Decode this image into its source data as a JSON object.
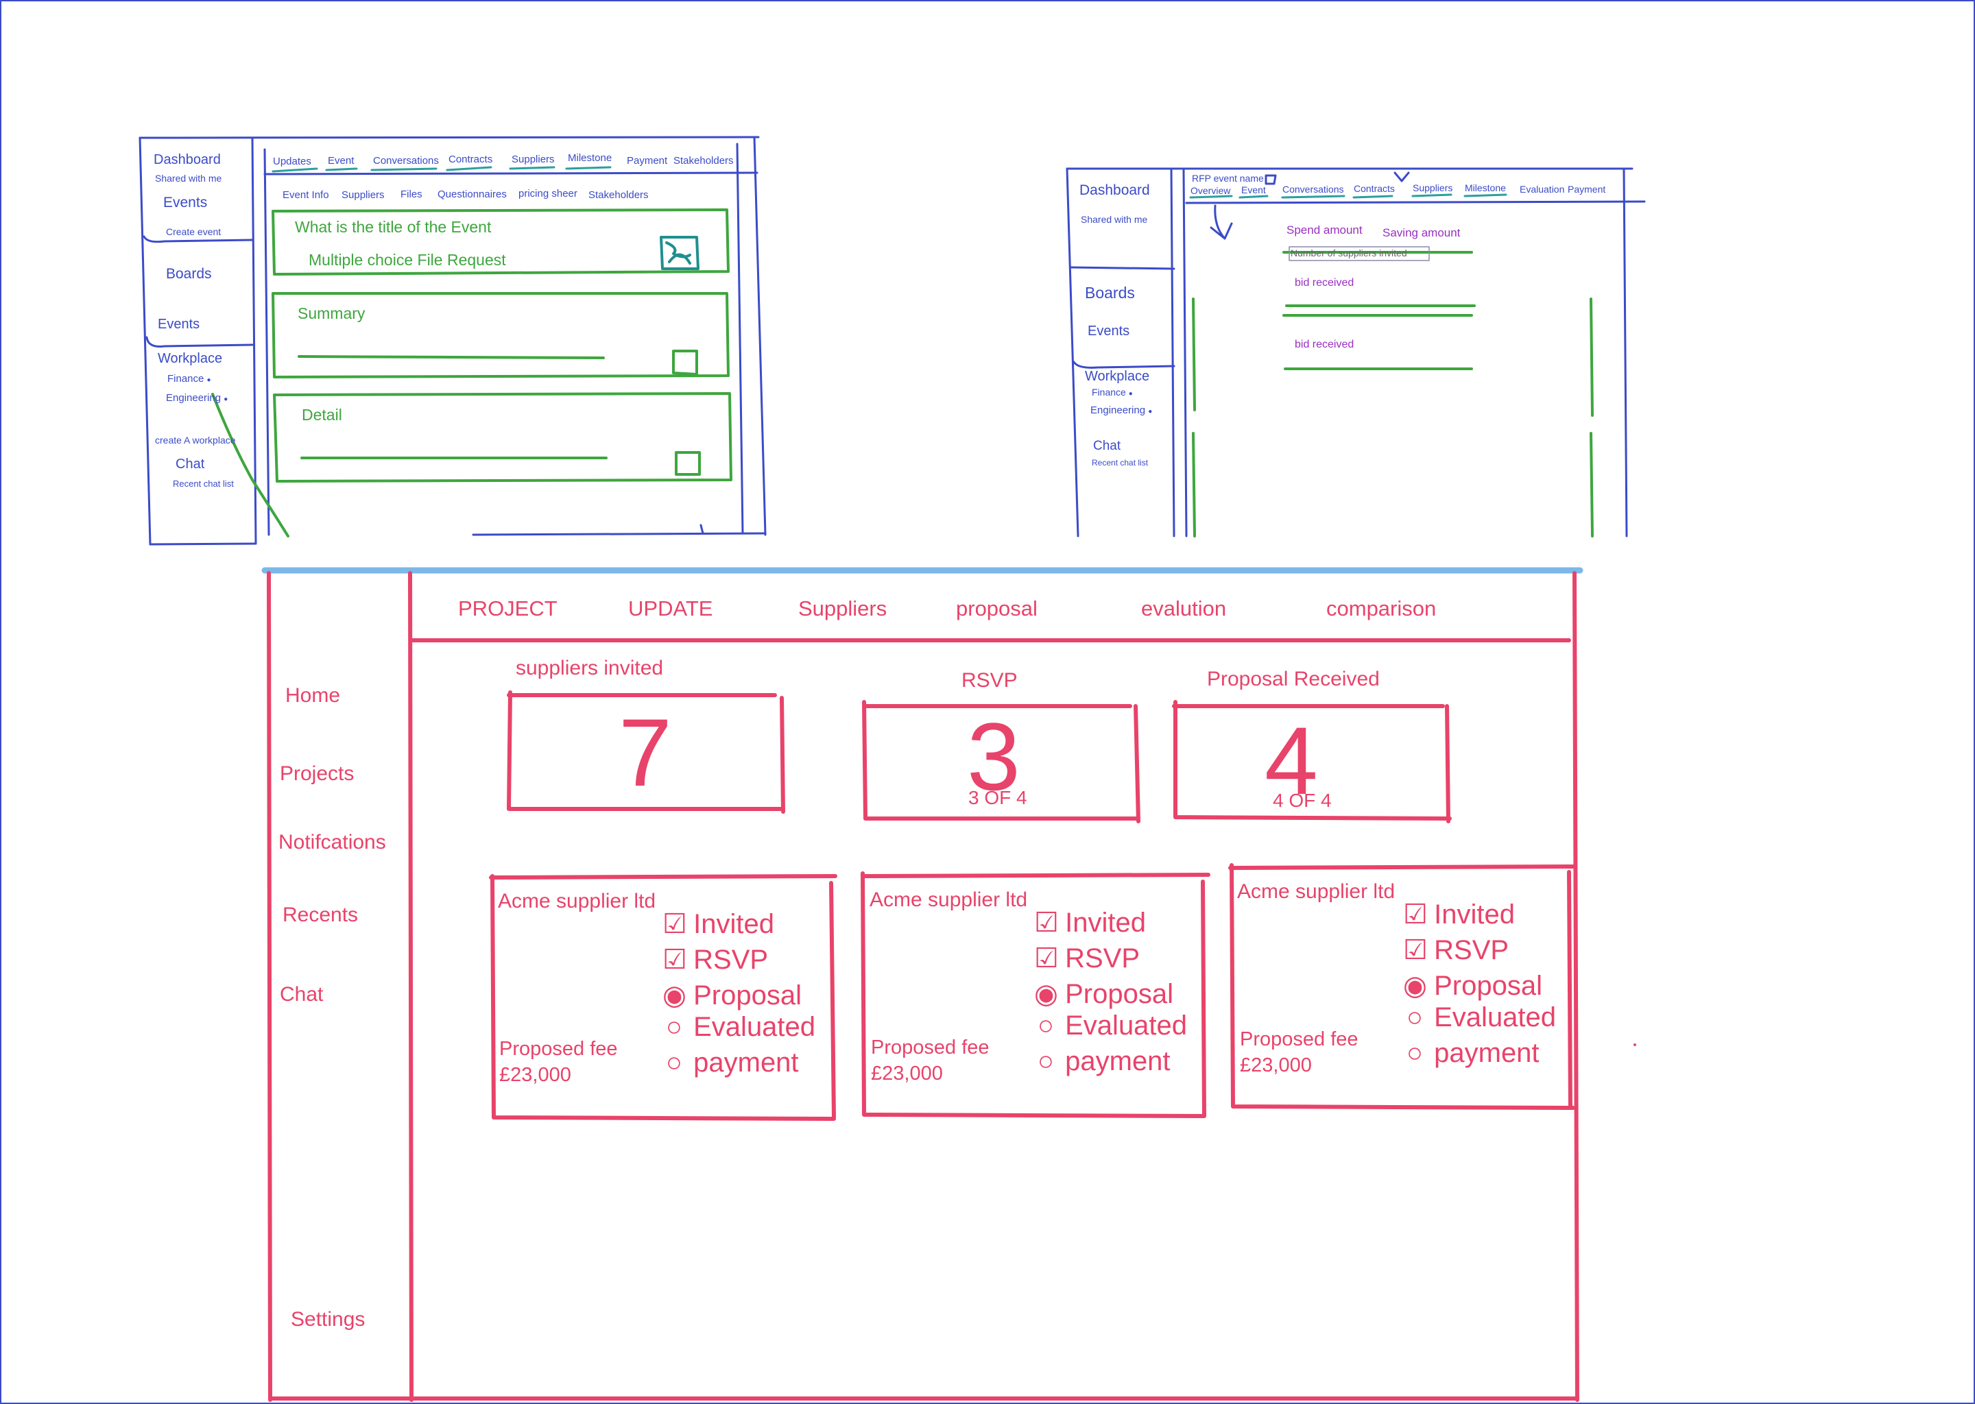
{
  "colors": {
    "blue": "#3b4bc8",
    "green": "#3ea63e",
    "purple": "#9a2fc0",
    "red": "#e8436a",
    "lightblue": "#7cb8e8"
  },
  "sketch1": {
    "sidebar": {
      "dashboard": "Dashboard",
      "shared": "Shared with me",
      "events": "Events",
      "create_event": "Create event",
      "boards": "Boards",
      "events2": "Events",
      "workplace": "Workplace",
      "finance": "Finance",
      "engineering": "Engineering",
      "create_workplace": "create A workplace",
      "chat": "Chat",
      "recent_chat": "Recent chat list"
    },
    "tabs": [
      "Updates",
      "Event",
      "Conversations",
      "Contracts",
      "Suppliers",
      "Milestone",
      "Payment",
      "Stakeholders"
    ],
    "subtabs": [
      "Event Info",
      "Suppliers",
      "Files",
      "Questionnaires",
      "pricing sheer",
      "Stakeholders"
    ],
    "card1": {
      "title": "What is the title of the Event",
      "subtitle": "Multiple choice File Request"
    },
    "card2": {
      "title": "Summary"
    },
    "card3": {
      "title": "Detail"
    }
  },
  "sketch2": {
    "sidebar": {
      "dashboard": "Dashboard",
      "shared": "Shared with me",
      "boards": "Boards",
      "events": "Events",
      "workplace": "Workplace",
      "finance": "Finance",
      "engineering": "Engineering",
      "chat": "Chat",
      "recent_chat": "Recent chat list"
    },
    "event_name": "RFP event name",
    "tabs": [
      "Overview",
      "Event",
      "Conversations",
      "Contracts",
      "Suppliers",
      "Milestone",
      "Evaluation",
      "Payment"
    ],
    "spend": "Spend amount",
    "saving": "Saving amount",
    "suppliers_invited": "Number of suppliers invited",
    "bid1": "bid received",
    "bid2": "bid received"
  },
  "main": {
    "sidebar": [
      "Home",
      "Projects",
      "Notifcations",
      "Recents",
      "Chat"
    ],
    "settings": "Settings",
    "tabs": [
      "PROJECT",
      "UPDATE",
      "Suppliers",
      "proposal",
      "evalution",
      "comparison"
    ],
    "stats": [
      {
        "label": "suppliers invited",
        "value": "7",
        "sub": ""
      },
      {
        "label": "RSVP",
        "value": "3",
        "sub": "3 OF 4"
      },
      {
        "label": "Proposal Received",
        "value": "4",
        "sub": "4 OF 4"
      }
    ],
    "suppliers": [
      {
        "name": "Acme supplier ltd",
        "fee_label": "Proposed fee",
        "fee": "£23,000",
        "steps": [
          {
            "label": "Invited",
            "state": "done"
          },
          {
            "label": "RSVP",
            "state": "done"
          },
          {
            "label": "Proposal",
            "state": "current"
          },
          {
            "label": "Evaluated",
            "state": "todo"
          },
          {
            "label": "payment",
            "state": "todo"
          }
        ]
      },
      {
        "name": "Acme supplier ltd",
        "fee_label": "Proposed fee",
        "fee": "£23,000",
        "steps": [
          {
            "label": "Invited",
            "state": "done"
          },
          {
            "label": "RSVP",
            "state": "done"
          },
          {
            "label": "Proposal",
            "state": "current"
          },
          {
            "label": "Evaluated",
            "state": "todo"
          },
          {
            "label": "payment",
            "state": "todo"
          }
        ]
      },
      {
        "name": "Acme supplier ltd",
        "fee_label": "Proposed fee",
        "fee": "£23,000",
        "steps": [
          {
            "label": "Invited",
            "state": "done"
          },
          {
            "label": "RSVP",
            "state": "done"
          },
          {
            "label": "Proposal",
            "state": "current"
          },
          {
            "label": "Evaluated",
            "state": "todo"
          },
          {
            "label": "payment",
            "state": "todo"
          }
        ]
      }
    ]
  }
}
